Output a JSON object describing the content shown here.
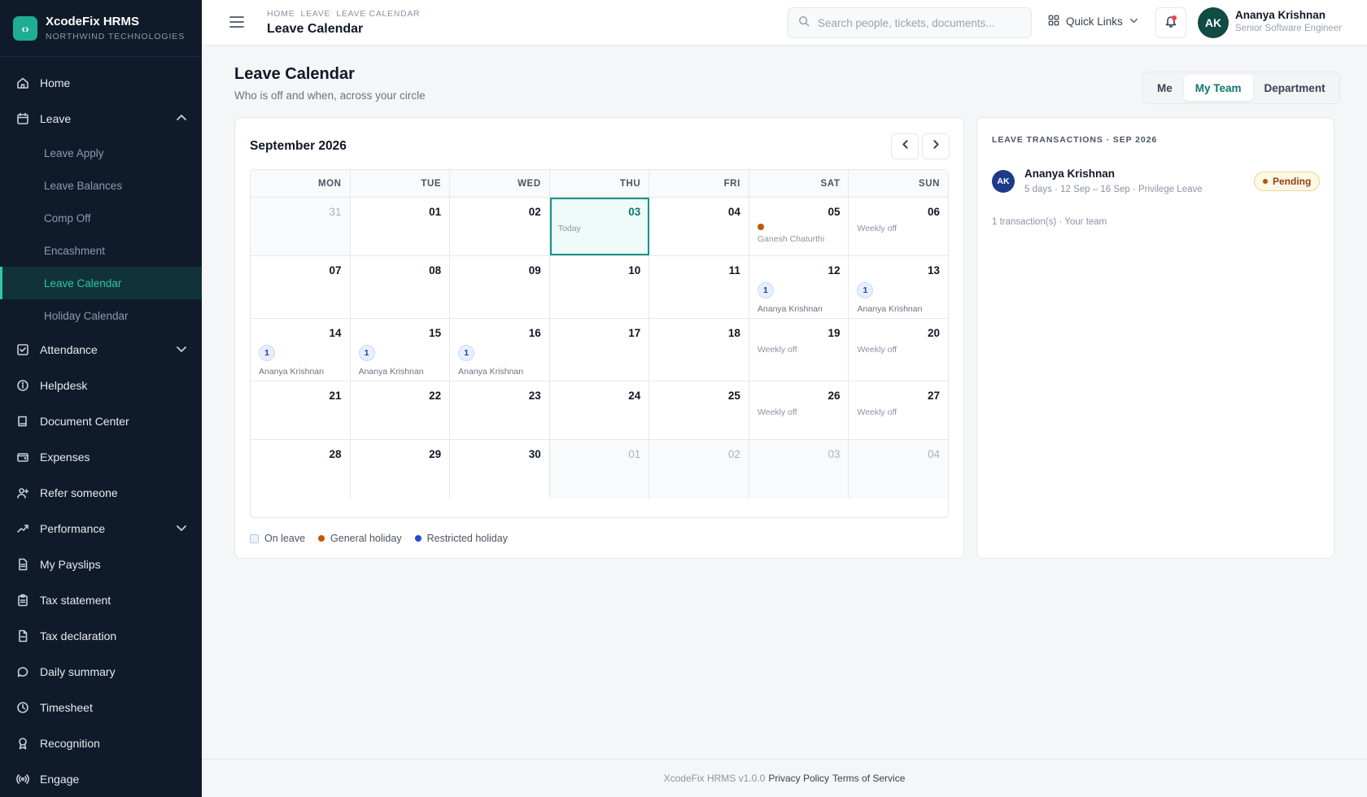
{
  "brand": {
    "name": "XcodeFix HRMS",
    "org": "NORTHWIND TECHNOLOGIES",
    "logo_glyph": "‹›"
  },
  "sidebar": {
    "items": [
      {
        "label": "Home",
        "icon": "home-icon"
      },
      {
        "label": "Leave",
        "icon": "calendar-icon",
        "expanded": true,
        "children": [
          "Leave Apply",
          "Leave Balances",
          "Comp Off",
          "Encashment",
          "Leave Calendar",
          "Holiday Calendar"
        ],
        "active_child": "Leave Calendar"
      },
      {
        "label": "Attendance",
        "icon": "attendance-icon",
        "expandable": true
      },
      {
        "label": "Helpdesk",
        "icon": "info-icon"
      },
      {
        "label": "Document Center",
        "icon": "book-icon"
      },
      {
        "label": "Expenses",
        "icon": "wallet-icon"
      },
      {
        "label": "Refer someone",
        "icon": "user-plus-icon"
      },
      {
        "label": "Performance",
        "icon": "trending-icon",
        "expandable": true
      },
      {
        "label": "My Payslips",
        "icon": "document-icon"
      },
      {
        "label": "Tax statement",
        "icon": "clipboard-icon"
      },
      {
        "label": "Tax declaration",
        "icon": "file-icon"
      },
      {
        "label": "Daily summary",
        "icon": "chat-icon"
      },
      {
        "label": "Timesheet",
        "icon": "clock-icon"
      },
      {
        "label": "Recognition",
        "icon": "award-icon"
      },
      {
        "label": "Engage",
        "icon": "broadcast-icon"
      }
    ]
  },
  "topbar": {
    "breadcrumb": "HOME  LEAVE  LEAVE CALENDAR",
    "title": "Leave Calendar",
    "search_placeholder": "Search people, tickets, documents...",
    "quick_links": "Quick Links",
    "user": {
      "initials": "AK",
      "name": "Ananya Krishnan",
      "role": "Senior Software Engineer"
    }
  },
  "page": {
    "title": "Leave Calendar",
    "subtitle": "Who is off and when, across your circle",
    "scope_tabs": [
      "Me",
      "My Team",
      "Department"
    ],
    "active_scope": "My Team"
  },
  "calendar": {
    "month_label": "September 2026",
    "weekdays": [
      "MON",
      "TUE",
      "WED",
      "THU",
      "FRI",
      "SAT",
      "SUN"
    ],
    "weeks": [
      [
        {
          "day": "31",
          "out": true
        },
        {
          "day": "01"
        },
        {
          "day": "02"
        },
        {
          "day": "03",
          "today": true,
          "note": "Today"
        },
        {
          "day": "04"
        },
        {
          "day": "05",
          "holiday": "Ganesh Chaturthi"
        },
        {
          "day": "06",
          "note": "Weekly off"
        }
      ],
      [
        {
          "day": "07"
        },
        {
          "day": "08"
        },
        {
          "day": "09"
        },
        {
          "day": "10"
        },
        {
          "day": "11"
        },
        {
          "day": "12",
          "leave_count": "1",
          "leave_name": "Ananya Krishnan"
        },
        {
          "day": "13",
          "leave_count": "1",
          "leave_name": "Ananya Krishnan"
        }
      ],
      [
        {
          "day": "14",
          "leave_count": "1",
          "leave_name": "Ananya Krishnan"
        },
        {
          "day": "15",
          "leave_count": "1",
          "leave_name": "Ananya Krishnan"
        },
        {
          "day": "16",
          "leave_count": "1",
          "leave_name": "Ananya Krishnan"
        },
        {
          "day": "17"
        },
        {
          "day": "18"
        },
        {
          "day": "19",
          "note": "Weekly off"
        },
        {
          "day": "20",
          "note": "Weekly off"
        }
      ],
      [
        {
          "day": "21"
        },
        {
          "day": "22"
        },
        {
          "day": "23"
        },
        {
          "day": "24"
        },
        {
          "day": "25"
        },
        {
          "day": "26",
          "note": "Weekly off"
        },
        {
          "day": "27",
          "note": "Weekly off"
        }
      ],
      [
        {
          "day": "28"
        },
        {
          "day": "29"
        },
        {
          "day": "30"
        },
        {
          "day": "01",
          "out": true
        },
        {
          "day": "02",
          "out": true
        },
        {
          "day": "03",
          "out": true
        },
        {
          "day": "04",
          "out": true
        }
      ]
    ],
    "legend": [
      {
        "label": "On leave",
        "kind": "box"
      },
      {
        "label": "General holiday",
        "kind": "dot",
        "color": "#c2560c"
      },
      {
        "label": "Restricted holiday",
        "kind": "dot",
        "color": "#1d4ed8"
      }
    ]
  },
  "transactions": {
    "heading": "LEAVE TRANSACTIONS · SEP 2026",
    "items": [
      {
        "initials": "AK",
        "name": "Ananya Krishnan",
        "meta": "5 days · 12 Sep – 16 Sep · Privilege Leave",
        "status": "Pending"
      }
    ],
    "count_text": "1 transaction(s) · Your team"
  },
  "footer": {
    "version": "XcodeFix HRMS v1.0.0",
    "privacy": "Privacy Policy",
    "terms": "Terms of Service"
  },
  "colors": {
    "sidebar_bg": "#0f1b2a",
    "accent": "#2dc7a8",
    "today_border": "#0f9488",
    "holiday": "#c2560c",
    "restricted": "#1d4ed8",
    "pending_bg": "#fff8e6"
  }
}
